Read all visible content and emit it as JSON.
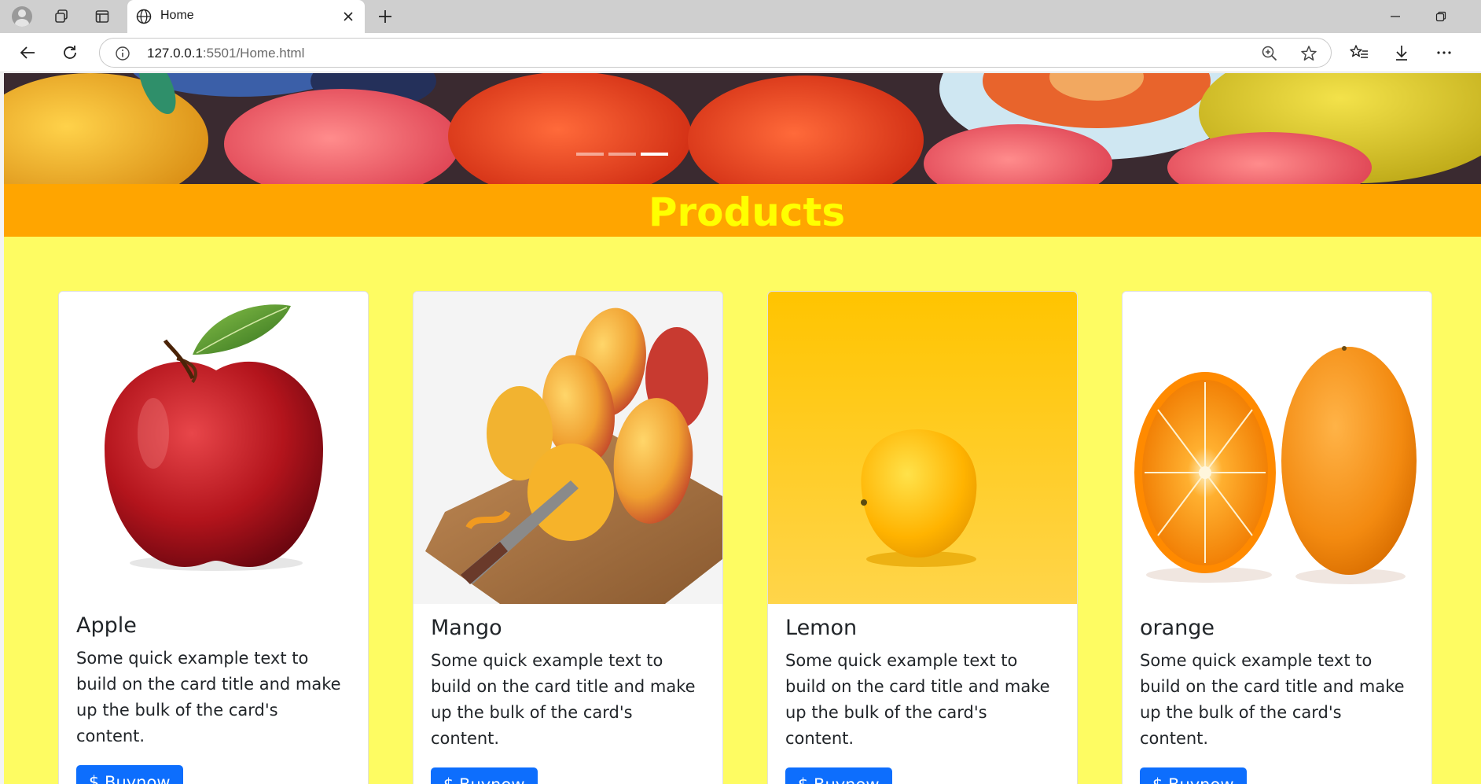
{
  "browser": {
    "tab_title": "Home",
    "url_host": "127.0.0.1",
    "url_rest": ":5501/Home.html"
  },
  "page": {
    "heading": "Products",
    "carousel": {
      "slide_count": 3,
      "active_index": 2
    },
    "cards": [
      {
        "title": "Apple",
        "text": "Some quick example text to build on the card title and make up the bulk of the card's content.",
        "button_label": "$ Buynow",
        "image": "apple-image"
      },
      {
        "title": "Mango",
        "text": "Some quick example text to build on the card title and make up the bulk of the card's content.",
        "button_label": "$ Buynow",
        "image": "mango-image"
      },
      {
        "title": "Lemon",
        "text": "Some quick example text to build on the card title and make up the bulk of the card's content.",
        "button_label": "$ Buynow",
        "image": "lemon-image"
      },
      {
        "title": "orange",
        "text": "Some quick example text to build on the card title and make up the bulk of the card's content.",
        "button_label": "$ Buynow",
        "image": "orange-image"
      }
    ]
  },
  "colors": {
    "page_background": "#fefc62",
    "band_background": "#ffa500",
    "heading_color": "#ffff00",
    "button_color": "#0d6efd"
  }
}
